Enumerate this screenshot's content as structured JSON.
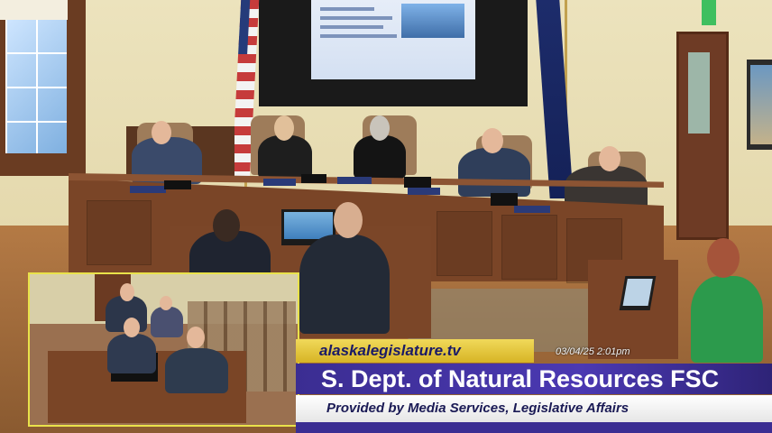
{
  "broadcast": {
    "site_url": "alaskalegislature.tv",
    "timestamp": "03/04/25  2:01pm",
    "committee_title": "S. Dept. of Natural Resources FSC",
    "credit_line": "Provided by Media Services, Legislative Affairs"
  },
  "scene": {
    "description_icons": [
      "us-flag-icon",
      "alaska-flag-icon",
      "projector-screen-icon",
      "exit-sign-icon"
    ]
  },
  "colors": {
    "title_bar": "#3b2d92",
    "url_bar": "#e4c337",
    "subtitle_bar": "#ffffff"
  }
}
